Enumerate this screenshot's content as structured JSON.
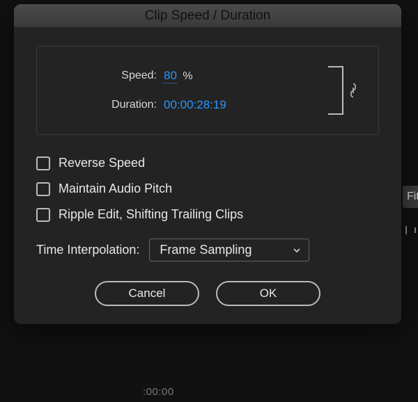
{
  "dialog": {
    "title": "Clip Speed / Duration",
    "speed_label": "Speed:",
    "speed_value": "80",
    "speed_suffix": "%",
    "duration_label": "Duration:",
    "duration_value": "00:00:28:19",
    "checkboxes": {
      "reverse": "Reverse Speed",
      "maintain_pitch": "Maintain Audio Pitch",
      "ripple": "Ripple Edit, Shifting Trailing Clips"
    },
    "interp_label": "Time Interpolation:",
    "interp_value": "Frame Sampling",
    "buttons": {
      "cancel": "Cancel",
      "ok": "OK"
    }
  },
  "background": {
    "fit_label": "Fit",
    "timecode": ":00:00"
  }
}
